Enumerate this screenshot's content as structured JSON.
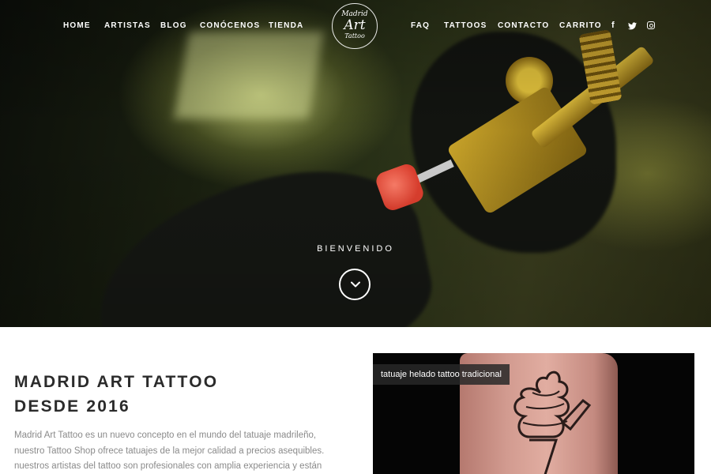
{
  "nav": {
    "left": [
      "HOME",
      "ARTISTAS",
      "BLOG",
      "CONÓCENOS",
      "TIENDA"
    ],
    "right": [
      "FAQ",
      "TATTOOS",
      "CONTACTO",
      "CARRITO"
    ]
  },
  "logo": {
    "line1": "Madrid",
    "line2": "Art",
    "line3": "Tattoo"
  },
  "social": {
    "facebook_glyph": "f",
    "icons": [
      "facebook-icon",
      "twitter-icon",
      "instagram-icon"
    ]
  },
  "hero": {
    "welcome": "BIENVENIDO",
    "scroll_icon": "chevron-down-icon"
  },
  "intro": {
    "title_line1": "MADRID ART TATTOO",
    "title_line2": "DESDE 2016",
    "description": "Madrid Art Tattoo es un nuevo concepto en el mundo del tatuaje madrileño, nuestro Tattoo Shop ofrece tatuajes de la mejor calidad a precios asequibles. nuestros artistas del tattoo son profesionales con amplia experiencia y están capacitados y"
  },
  "gallery": {
    "caption": "tatuaje helado tattoo tradicional"
  },
  "colors": {
    "text_dark": "#2b2b2b",
    "text_muted": "#8a8a8a",
    "white": "#ffffff"
  }
}
